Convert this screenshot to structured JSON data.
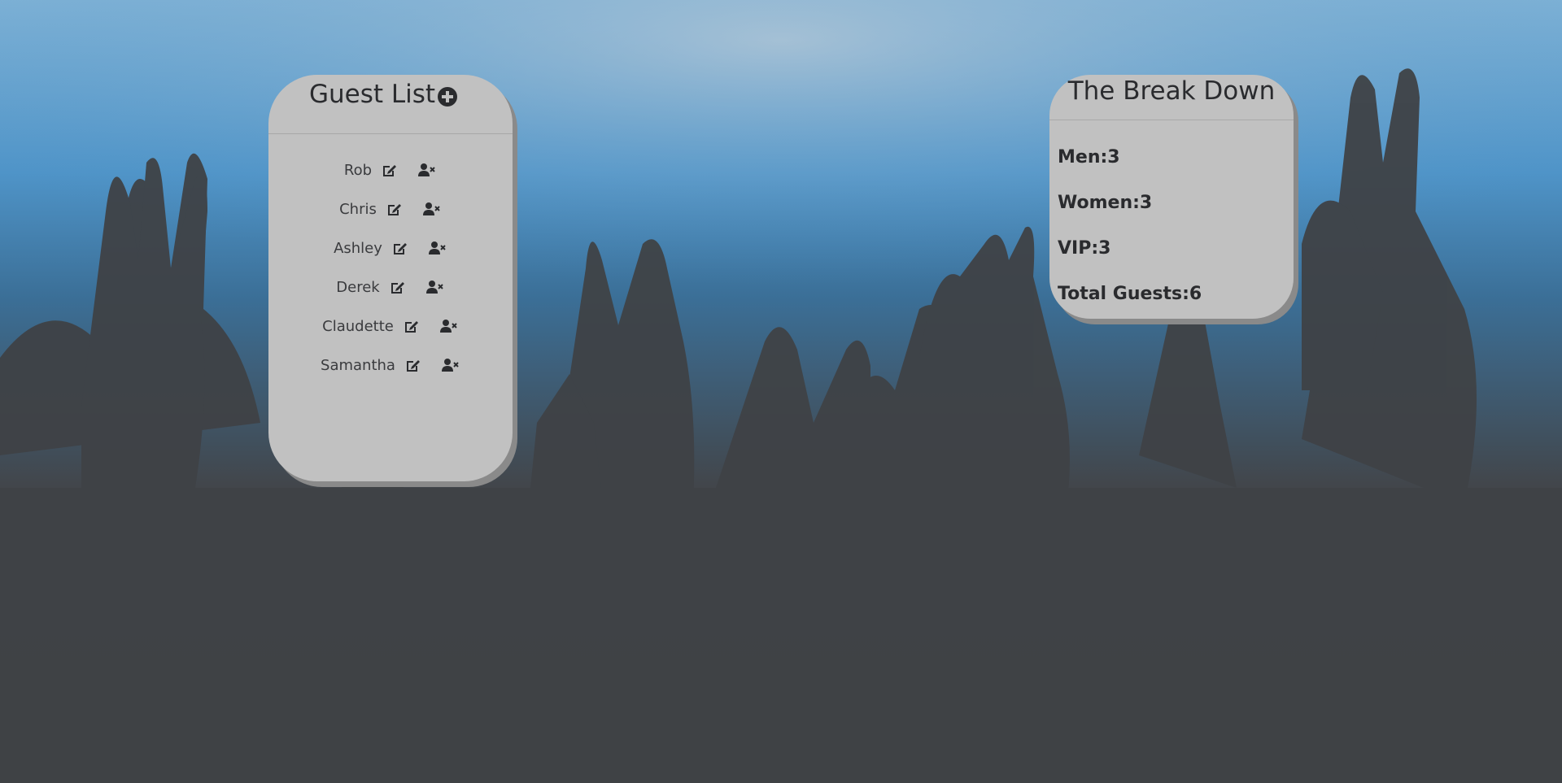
{
  "guest_list": {
    "title": "Guest List",
    "add_icon": "plus-circle-icon",
    "edit_icon": "edit-icon",
    "remove_icon": "user-remove-icon",
    "guests": [
      {
        "name": "Rob"
      },
      {
        "name": "Chris"
      },
      {
        "name": "Ashley"
      },
      {
        "name": "Derek"
      },
      {
        "name": "Claudette"
      },
      {
        "name": "Samantha"
      }
    ]
  },
  "breakdown": {
    "title": "The Break Down",
    "men": "Men:3",
    "women": "Women:3",
    "vip": "VIP:3",
    "total": "Total Guests:6"
  },
  "colors": {
    "card_bg": "#c1c1c1",
    "text": "#2a2b2e",
    "sky": "#4f94c8",
    "crowd": "#424448"
  }
}
